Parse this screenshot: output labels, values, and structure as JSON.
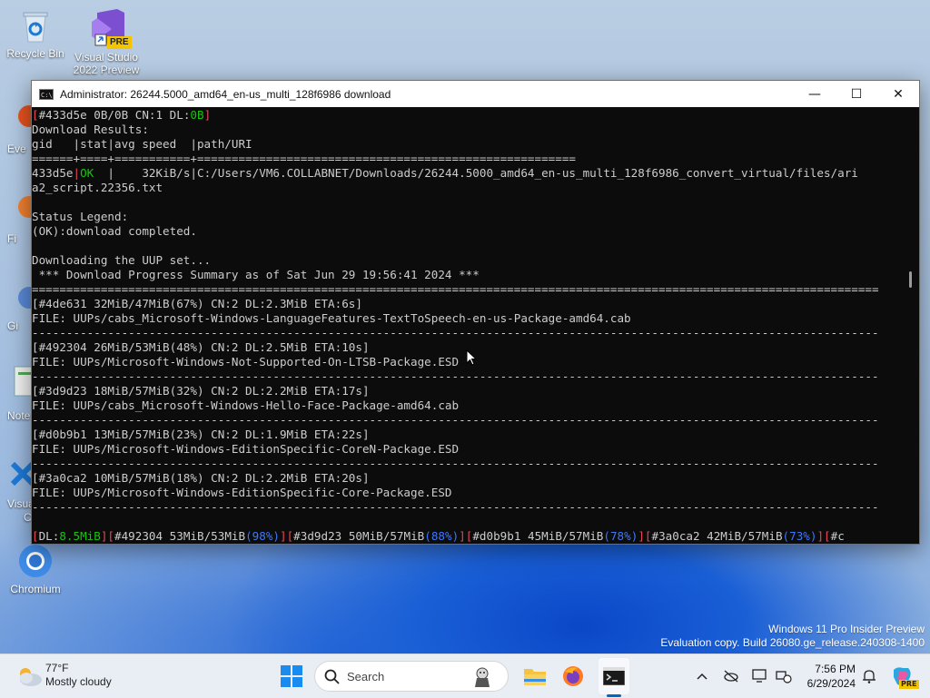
{
  "desktop": {
    "icons": [
      {
        "label": "Recycle Bin",
        "icon": "recycle-bin-icon"
      },
      {
        "label": "Visual Studio 2022 Preview",
        "label_line1": "Visual Studio",
        "label_line2": "2022 Preview",
        "badge": "PRE",
        "icon": "visual-studio-icon"
      },
      {
        "label": "Chromium",
        "icon": "chromium-icon"
      }
    ],
    "partial_labels": [
      "Eve",
      "Fi",
      "Gi",
      "Note",
      "Visua",
      "C"
    ]
  },
  "window": {
    "title": "Administrator:  26244.5000_amd64_en-us_multi_128f6986 download",
    "minimize": "—",
    "maximize": "☐",
    "close": "✕"
  },
  "console": {
    "lines": [
      [
        {
          "t": "[",
          "c": "red"
        },
        {
          "t": "#433d5e 0B/0B CN:1 DL:"
        },
        {
          "t": "0B",
          "c": "green"
        },
        {
          "t": "]",
          "c": "red"
        }
      ],
      [
        {
          "t": "Download Results:"
        }
      ],
      [
        {
          "t": "gid   |stat|avg speed  |path/URI"
        }
      ],
      [
        {
          "t": "======+====+===========+======================================================="
        }
      ],
      [
        {
          "t": "433d5e"
        },
        {
          "t": "|",
          "c": "red"
        },
        {
          "t": "OK",
          "c": "green"
        },
        {
          "t": "  |    32KiB/s|C:/Users/VM6.COLLABNET/Downloads/26244.5000_amd64_en-us_multi_128f6986_convert_virtual/files/ari"
        }
      ],
      [
        {
          "t": "a2_script.22356.txt"
        }
      ],
      [
        {
          "t": ""
        }
      ],
      [
        {
          "t": "Status Legend:"
        }
      ],
      [
        {
          "t": "(OK):download completed."
        }
      ],
      [
        {
          "t": ""
        }
      ],
      [
        {
          "t": "Downloading the UUP set..."
        }
      ],
      [
        {
          "t": " *** Download Progress Summary as of Sat Jun 29 19:56:41 2024 ***"
        }
      ],
      [
        {
          "t": "==========================================================================================================================="
        }
      ],
      [
        {
          "t": "[#4de631 32MiB/47MiB(67%) CN:2 DL:2.3MiB ETA:6s]"
        }
      ],
      [
        {
          "t": "FILE: UUPs/cabs_Microsoft-Windows-LanguageFeatures-TextToSpeech-en-us-Package-amd64.cab"
        }
      ],
      [
        {
          "t": "---------------------------------------------------------------------------------------------------------------------------"
        }
      ],
      [
        {
          "t": "[#492304 26MiB/53MiB(48%) CN:2 DL:2.5MiB ETA:10s]"
        }
      ],
      [
        {
          "t": "FILE: UUPs/Microsoft-Windows-Not-Supported-On-LTSB-Package.ESD"
        }
      ],
      [
        {
          "t": "---------------------------------------------------------------------------------------------------------------------------"
        }
      ],
      [
        {
          "t": "[#3d9d23 18MiB/57MiB(32%) CN:2 DL:2.2MiB ETA:17s]"
        }
      ],
      [
        {
          "t": "FILE: UUPs/cabs_Microsoft-Windows-Hello-Face-Package-amd64.cab"
        }
      ],
      [
        {
          "t": "---------------------------------------------------------------------------------------------------------------------------"
        }
      ],
      [
        {
          "t": "[#d0b9b1 13MiB/57MiB(23%) CN:2 DL:1.9MiB ETA:22s]"
        }
      ],
      [
        {
          "t": "FILE: UUPs/Microsoft-Windows-EditionSpecific-CoreN-Package.ESD"
        }
      ],
      [
        {
          "t": "---------------------------------------------------------------------------------------------------------------------------"
        }
      ],
      [
        {
          "t": "[#3a0ca2 10MiB/57MiB(18%) CN:2 DL:2.2MiB ETA:20s]"
        }
      ],
      [
        {
          "t": "FILE: UUPs/Microsoft-Windows-EditionSpecific-Core-Package.ESD"
        }
      ],
      [
        {
          "t": "---------------------------------------------------------------------------------------------------------------------------"
        }
      ],
      [
        {
          "t": ""
        }
      ],
      [
        {
          "t": "[",
          "c": "red"
        },
        {
          "t": "DL:"
        },
        {
          "t": "8.5MiB",
          "c": "green"
        },
        {
          "t": "][",
          "c": "red"
        },
        {
          "t": "#492304 53MiB/53MiB"
        },
        {
          "t": "(98%)",
          "c": "blue"
        },
        {
          "t": "][",
          "c": "red"
        },
        {
          "t": "#3d9d23 50MiB/57MiB"
        },
        {
          "t": "(88%)",
          "c": "blue"
        },
        {
          "t": "][",
          "c": "red"
        },
        {
          "t": "#d0b9b1 45MiB/57MiB"
        },
        {
          "t": "(78%)",
          "c": "blue"
        },
        {
          "t": "][",
          "c": "red"
        },
        {
          "t": "#3a0ca2 42MiB/57MiB"
        },
        {
          "t": "(73%)",
          "c": "blue"
        },
        {
          "t": "][",
          "c": "red"
        },
        {
          "t": "#c"
        }
      ]
    ]
  },
  "watermark": {
    "line1": "Windows 11 Pro Insider Preview",
    "line2": "Evaluation copy. Build 26080.ge_release.240308-1400"
  },
  "taskbar": {
    "weather_temp": "77°F",
    "weather_desc": "Mostly cloudy",
    "search_label": "Search",
    "time": "7:56 PM",
    "date": "6/29/2024",
    "copilot_badge": "PRE"
  },
  "colors": {
    "console_bg": "#0c0c0c",
    "console_fg": "#cccccc",
    "red": "#e74856",
    "green": "#16c60c",
    "blue": "#3b78ff",
    "accent": "#0067c0"
  }
}
